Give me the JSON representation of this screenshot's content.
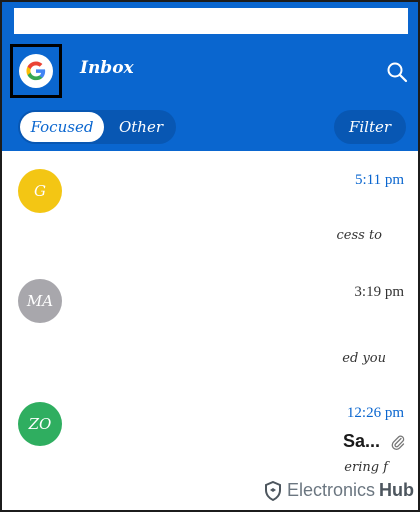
{
  "header": {
    "title": "Inbox",
    "account_icon": "google-g-icon",
    "search_icon": "search-icon"
  },
  "tabs": {
    "focused": "Focused",
    "other": "Other"
  },
  "filter_label": "Filter",
  "messages": [
    {
      "avatar_text": "G",
      "avatar_color": "#f3c614",
      "time": "5:11 pm",
      "time_color": "#0a66cf",
      "snippet": "cess to"
    },
    {
      "avatar_text": "MA",
      "avatar_color": "#a8a7ac",
      "time": "3:19 pm",
      "time_color": "#333333",
      "snippet": "ed you"
    },
    {
      "avatar_text": "ZO",
      "avatar_color": "#2fae60",
      "time": "12:26 pm",
      "time_color": "#0a66cf",
      "sender": "Sa...",
      "snippet": "ering f",
      "attachment_icon": "paperclip-icon"
    }
  ],
  "watermark": {
    "part1": "Electronics",
    "part2": "Hub"
  },
  "colors": {
    "brand": "#0a66cf"
  }
}
